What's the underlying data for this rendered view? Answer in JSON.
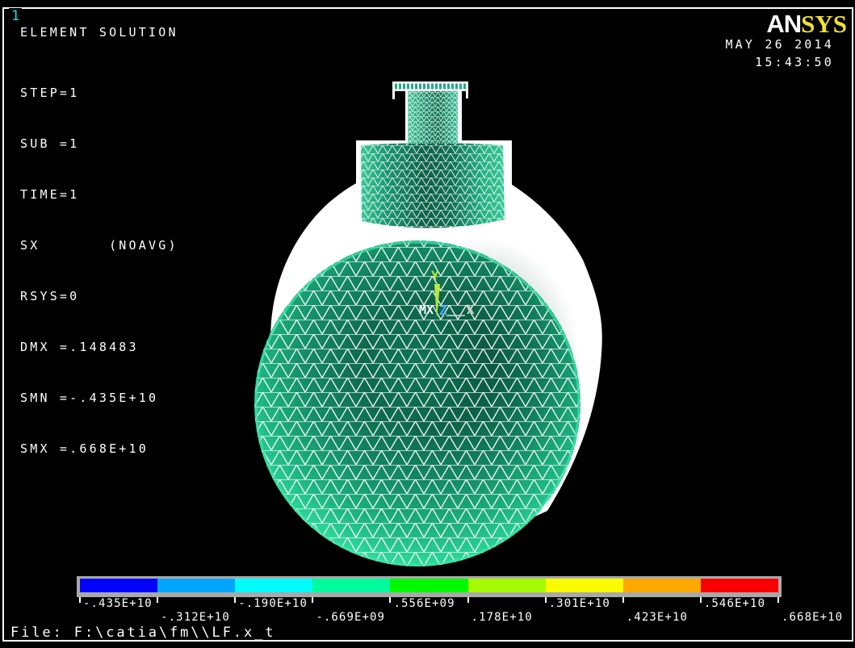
{
  "window": {
    "plot_number": "1"
  },
  "logo": {
    "an": "AN",
    "sys": "SYS",
    "sys_color": "#f0e130"
  },
  "datetime": {
    "date": "MAY 26 2014",
    "time": "15:43:50"
  },
  "annotations": {
    "title": "ELEMENT SOLUTION",
    "lines": [
      "STEP=1",
      "SUB =1",
      "TIME=1",
      "SX       (NOAVG)",
      "RSYS=0",
      "DMX =.148483",
      "SMN =-.435E+10",
      "SMX =.668E+10"
    ]
  },
  "triad": {
    "x": "X",
    "y": "Y",
    "z": "Z",
    "max_marker": "MX"
  },
  "colorbar": {
    "colors": [
      "#0202f8",
      "#00a6fb",
      "#00fbfb",
      "#00fb9e",
      "#00f800",
      "#a6fb00",
      "#fbfb00",
      "#ffa800",
      "#f80000"
    ],
    "labels_top": [
      "-.435E+10",
      "-.190E+10",
      ".556E+09",
      ".301E+10",
      ".546E+10"
    ],
    "labels_bottom": [
      "-.312E+10",
      "-.669E+09",
      ".178E+10",
      ".423E+10",
      ".668E+10"
    ],
    "min": "-.435E+10",
    "max": ".668E+10",
    "frame_color": "#a9a9a9"
  },
  "footer": {
    "file_label": "File: F:\\catia\\fm\\\\LF.x_t"
  },
  "model": {
    "background": "#000000",
    "wireframe_color": "#ffffff",
    "fill_dark": "#0d6a4d",
    "fill_light": "#41e7ab",
    "silhouette_color": "#ffffff",
    "triad_y_color": "#b9ea3c",
    "triad_z_color": "#49a8f8"
  }
}
